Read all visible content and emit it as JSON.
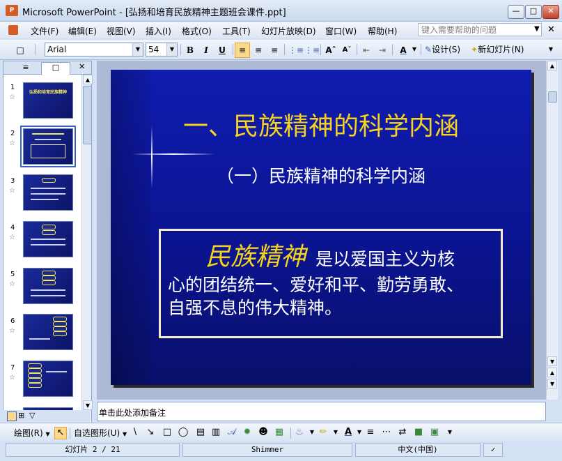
{
  "window": {
    "title": "Microsoft PowerPoint - [弘扬和培育民族精神主题班会课件.ppt]",
    "app_icon_text": "P"
  },
  "menubar": {
    "items": [
      "文件(F)",
      "编辑(E)",
      "视图(V)",
      "插入(I)",
      "格式(O)",
      "工具(T)",
      "幻灯片放映(D)",
      "窗口(W)",
      "帮助(H)"
    ],
    "help_placeholder": "键入需要帮助的问题"
  },
  "toolbar": {
    "font_name": "Arial",
    "font_size": "54",
    "bold": "B",
    "italic": "I",
    "underline": "U",
    "design_label": "设计(S)",
    "new_slide_label": "新幻灯片(N)"
  },
  "slides_pane": {
    "thumbnails": [
      {
        "number": "1",
        "title": "弘扬和培育民族精神"
      },
      {
        "number": "2"
      },
      {
        "number": "3"
      },
      {
        "number": "4"
      },
      {
        "number": "5"
      },
      {
        "number": "6"
      },
      {
        "number": "7"
      }
    ],
    "selected": "2"
  },
  "slide": {
    "title": "一、民族精神的科学内涵",
    "subtitle": "（一）民族精神的科学内涵",
    "keyword": "民族精神",
    "line1_rest": "是以爱国主义为核",
    "line2": "心的团结统一、爱好和平、勤劳勇敢、",
    "line3": "自强不息的伟大精神。"
  },
  "notes": {
    "placeholder": "单击此处添加备注"
  },
  "drawbar": {
    "draw_label": "绘图(R)",
    "autoshapes_label": "自选图形(U)"
  },
  "statusbar": {
    "slide_position": "幻灯片 2 / 21",
    "design_template": "Shimmer",
    "language": "中文(中国)"
  },
  "colors": {
    "slide_title": "#f7d21e",
    "slide_bg": "#0f1cb0",
    "keyword": "#f5d21b"
  }
}
